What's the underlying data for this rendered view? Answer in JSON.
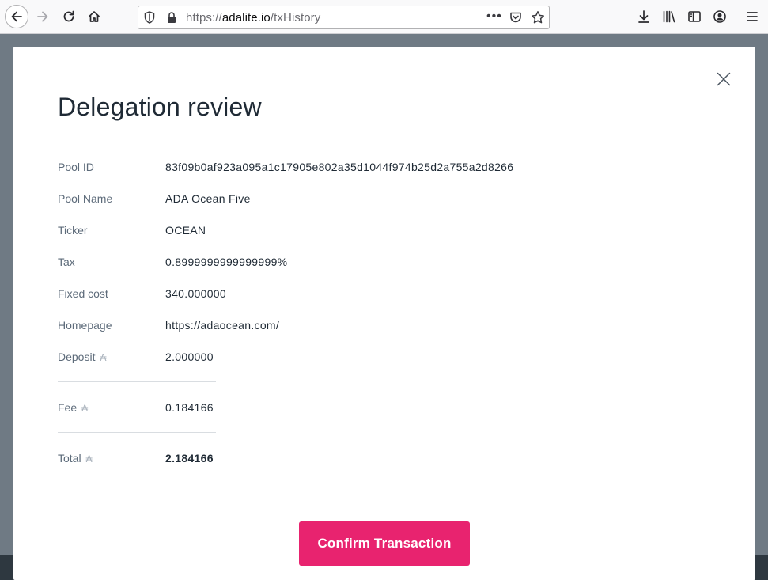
{
  "browser": {
    "url_scheme": "https://",
    "url_host": "adalite.io",
    "url_path": "/txHistory",
    "menu_dots": "•••"
  },
  "modal": {
    "title": "Delegation review",
    "ada_symbol": "₳",
    "rows": {
      "pool_id": {
        "label": "Pool ID",
        "value": "83f09b0af923a095a1c17905e802a35d1044f974b25d2a755a2d8266"
      },
      "pool_name": {
        "label": "Pool Name",
        "value": "ADA Ocean Five"
      },
      "ticker": {
        "label": "Ticker",
        "value": "OCEAN"
      },
      "tax": {
        "label": "Tax",
        "value": "0.8999999999999999%"
      },
      "fixed_cost": {
        "label": "Fixed cost",
        "value": "340.000000"
      },
      "homepage": {
        "label": "Homepage",
        "value": "https://adaocean.com/"
      },
      "deposit": {
        "label": "Deposit",
        "value": "2.000000"
      },
      "fee": {
        "label": "Fee",
        "value": "0.184166"
      },
      "total": {
        "label": "Total",
        "value": "2.184166"
      }
    },
    "confirm_label": "Confirm Transaction"
  },
  "colors": {
    "accent": "#e8236f",
    "backdrop": "#6f7a84",
    "text_dark": "#1f2a35",
    "text_label": "#5d6b7a"
  }
}
